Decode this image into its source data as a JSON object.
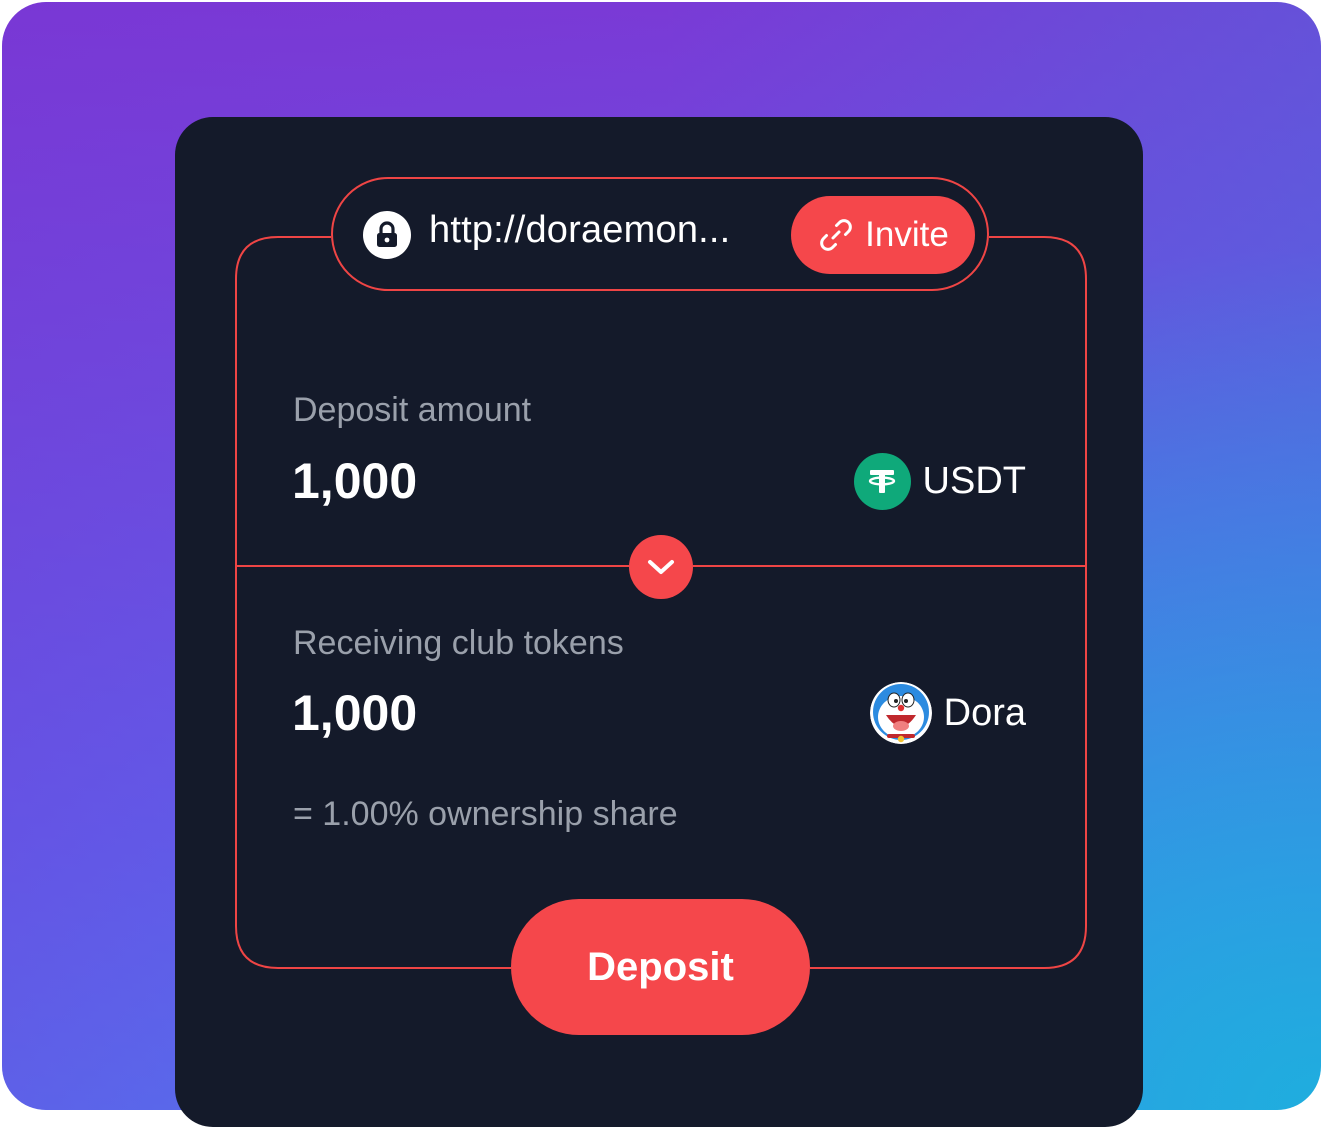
{
  "invite_bar": {
    "url": "http://doraemon...",
    "invite_label": "Invite",
    "lock_icon": "lock-icon",
    "link_icon": "link-icon"
  },
  "deposit": {
    "label": "Deposit amount",
    "amount": "1,000",
    "token_name": "USDT",
    "token_icon": "usdt-icon"
  },
  "receive": {
    "label": "Receiving club tokens",
    "amount": "1,000",
    "token_name": "Dora",
    "token_icon": "dora-icon",
    "ownership_text": "= 1.00% ownership share"
  },
  "swap_icon": "chevron-down-icon",
  "deposit_button": {
    "label": "Deposit"
  },
  "colors": {
    "accent": "#f5474b",
    "panel": "#141a2a",
    "usdt": "#0fa97a",
    "muted_text": "#9aa0ab"
  }
}
